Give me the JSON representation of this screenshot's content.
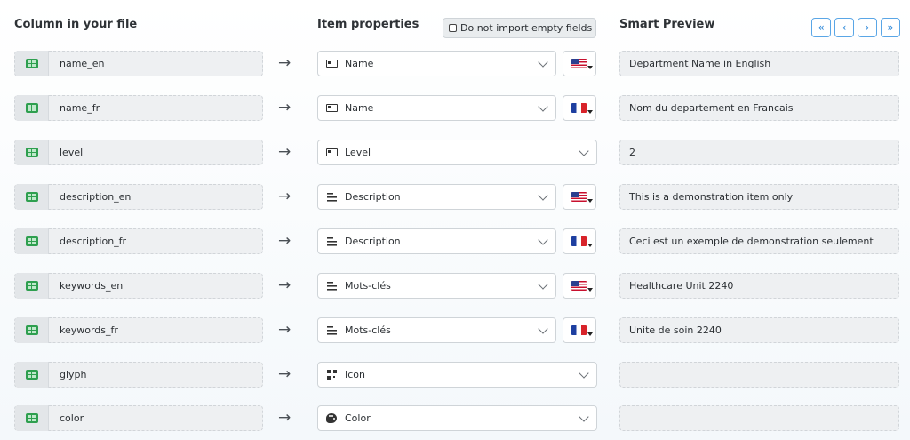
{
  "headers": {
    "column": "Column in your file",
    "properties": "Item properties",
    "preview": "Smart Preview",
    "skip_empty": "Do not import empty fields"
  },
  "pager": {
    "first_icon": "double-chevron-left-icon",
    "prev_icon": "chevron-left-icon",
    "next_icon": "chevron-right-icon",
    "last_icon": "double-chevron-right-icon"
  },
  "colors": {
    "accent": "#2a86d8",
    "sheet": "#2e9f4f"
  },
  "rows": [
    {
      "column": "name_en",
      "property": "Name",
      "icon": "id-card-icon",
      "lang": "us",
      "preview": "Department Name in English"
    },
    {
      "column": "name_fr",
      "property": "Name",
      "icon": "id-card-icon",
      "lang": "fr",
      "preview": "Nom du departement en Francais"
    },
    {
      "column": "level",
      "property": "Level",
      "icon": "id-card-icon",
      "lang": "",
      "preview": "2"
    },
    {
      "column": "description_en",
      "property": "Description",
      "icon": "text-lines-icon",
      "lang": "us",
      "preview": "This is a demonstration item only"
    },
    {
      "column": "description_fr",
      "property": "Description",
      "icon": "text-lines-icon",
      "lang": "fr",
      "preview": "Ceci est un exemple de demonstration seulement"
    },
    {
      "column": "keywords_en",
      "property": "Mots-clés",
      "icon": "text-lines-icon",
      "lang": "us",
      "preview": "Healthcare Unit 2240"
    },
    {
      "column": "keywords_fr",
      "property": "Mots-clés",
      "icon": "text-lines-icon",
      "lang": "fr",
      "preview": "Unite de soin 2240"
    },
    {
      "column": "glyph",
      "property": "Icon",
      "icon": "glyph-icon",
      "lang": "",
      "preview": ""
    },
    {
      "column": "color",
      "property": "Color",
      "icon": "palette-icon",
      "lang": "",
      "preview": ""
    }
  ]
}
